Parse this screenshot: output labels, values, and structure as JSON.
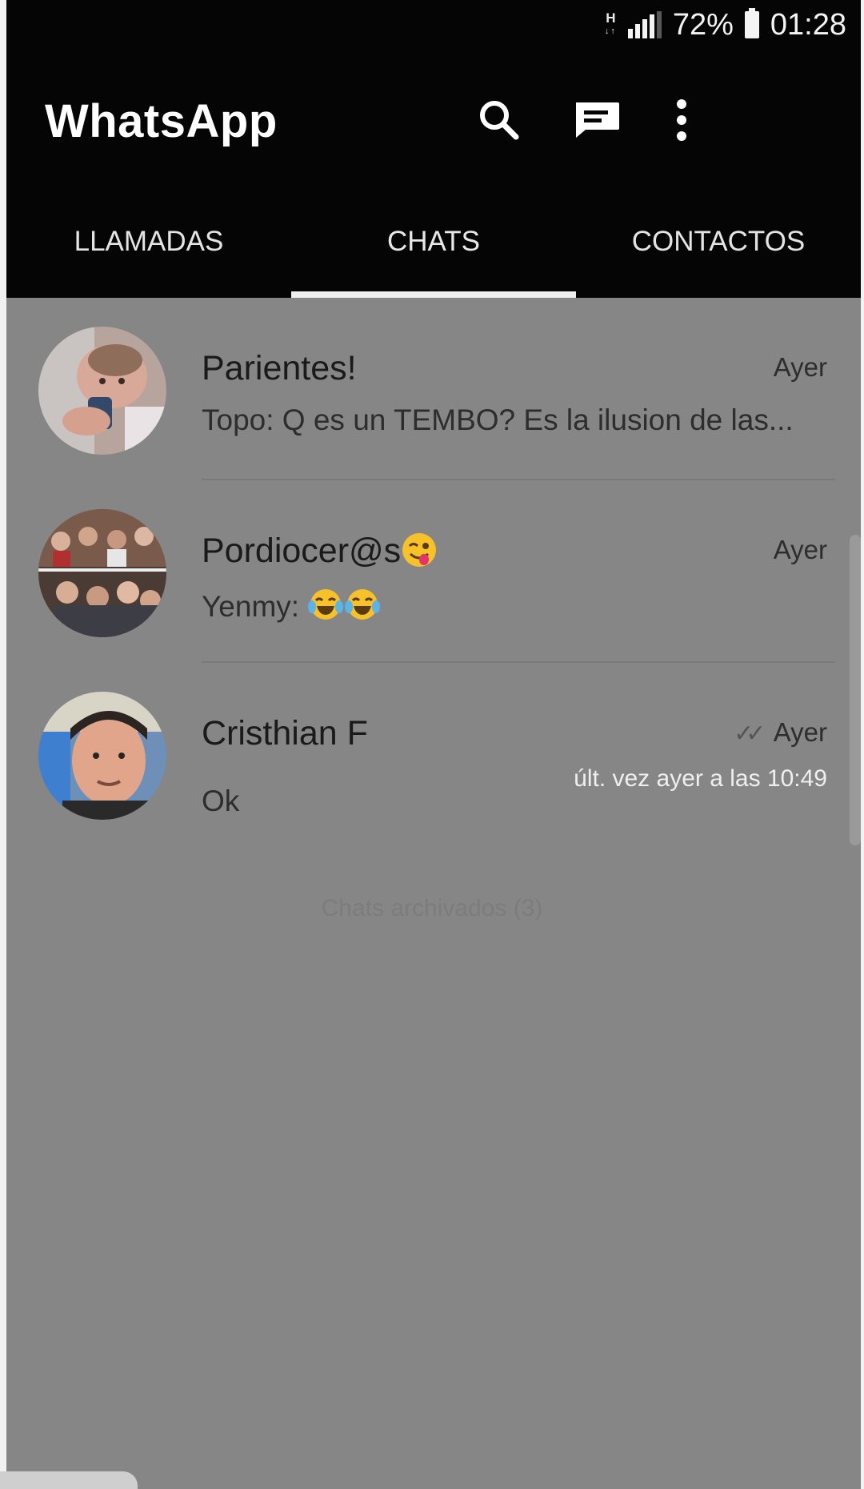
{
  "status_bar": {
    "network_type": "H",
    "battery_percent": "72%",
    "time": "01:28",
    "signal_level": 0.8
  },
  "header": {
    "title": "WhatsApp",
    "icons": [
      "search-icon",
      "new-chat-icon",
      "more-options-icon"
    ]
  },
  "tabs": [
    {
      "label": "LLAMADAS",
      "active": false
    },
    {
      "label": "CHATS",
      "active": true
    },
    {
      "label": "CONTACTOS",
      "active": false
    }
  ],
  "chats": [
    {
      "name": "Parientes!",
      "time": "Ayer",
      "preview": "Topo: Q es un TEMBO?  Es la ilusion de las...",
      "avatar": "baby-photo"
    },
    {
      "name": "Pordiocer@s",
      "name_emoji": "winking-face-with-tongue",
      "time": "Ayer",
      "preview": "Yenmy: ",
      "preview_emoji": [
        "tears-of-joy",
        "tears-of-joy"
      ],
      "avatar": "group-collage-photo"
    },
    {
      "name": "Cristhian F",
      "time": "Ayer",
      "last_seen": "últ. vez ayer a las 10:49",
      "preview": "Ok",
      "read_ticks": true,
      "avatar": "man-portrait-photo"
    }
  ],
  "archived_label": "Chats archivados (3)",
  "colors": {
    "header_bg": "#050505",
    "list_bg": "#868686",
    "tab_indicator": "#efefef"
  }
}
